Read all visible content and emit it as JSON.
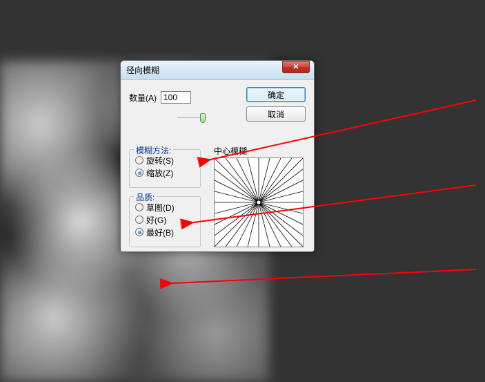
{
  "dialog": {
    "title": "径向模糊",
    "amount_label": "数量(A)",
    "amount_value": "100",
    "ok_label": "确定",
    "cancel_label": "取消",
    "center_label": "中心模糊"
  },
  "method_group": {
    "legend": "模糊方法:",
    "options": [
      {
        "label": "旋转(S)",
        "checked": false
      },
      {
        "label": "缩放(Z)",
        "checked": true
      }
    ]
  },
  "quality_group": {
    "legend": "品质:",
    "options": [
      {
        "label": "草图(D)",
        "checked": false
      },
      {
        "label": "好(G)",
        "checked": false
      },
      {
        "label": "最好(B)",
        "checked": true
      }
    ]
  },
  "close_icon": "✕"
}
